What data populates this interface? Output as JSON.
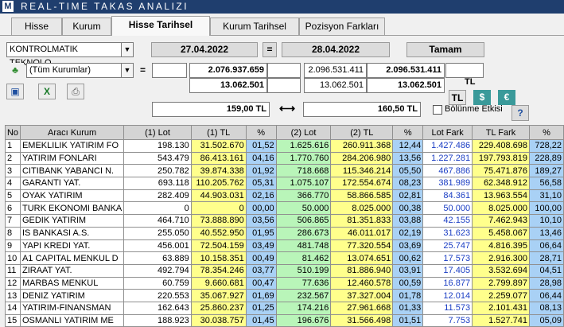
{
  "window": {
    "logo": "M",
    "title": "REAL-TIME TAKAS ANALIZI"
  },
  "tabs": [
    "Hisse",
    "Kurum",
    "Hisse Tarihsel",
    "Kurum Tarihsel",
    "Pozisyon Farkları"
  ],
  "filters": {
    "stock": "KONTROLMATIK TEKNOLO",
    "institution": "(Tüm Kurumlar)",
    "date_from": "27.04.2022",
    "eq": "=",
    "date_to": "28.04.2022",
    "ok_button": "Tamam",
    "eq2": "="
  },
  "summary": {
    "val1a": "2.076.937.659",
    "val1b": "2.096.531.411",
    "val1c": "2.096.531.411",
    "val2a": "13.062.501",
    "val2b": "13.062.501",
    "val2c": "13.062.501",
    "price1": "159,00 TL",
    "arrow": "⟷",
    "price2": "160,50 TL",
    "split_label": "Bölünme Etkisi",
    "currency_label": "TL",
    "currency_tl": "TL",
    "currency_usd": "$",
    "currency_eur": "€",
    "help": "?"
  },
  "table": {
    "headers": [
      "No",
      "Aracı Kurum",
      "(1) Lot",
      "(1) TL",
      "%",
      "(2) Lot",
      "(2) TL",
      "%",
      "Lot Fark",
      "TL Fark",
      "%"
    ],
    "rows": [
      [
        "1",
        "EMEKLILIK YATIRIM FO",
        "198.130",
        "31.502.670",
        "01,52",
        "1.625.616",
        "260.911.368",
        "12,44",
        "1.427.486",
        "229.408.698",
        "728,22"
      ],
      [
        "2",
        "YATIRIM FONLARI",
        "543.479",
        "86.413.161",
        "04,16",
        "1.770.760",
        "284.206.980",
        "13,56",
        "1.227.281",
        "197.793.819",
        "228,89"
      ],
      [
        "3",
        "CITIBANK YABANCI N.",
        "250.782",
        "39.874.338",
        "01,92",
        "718.668",
        "115.346.214",
        "05,50",
        "467.886",
        "75.471.876",
        "189,27"
      ],
      [
        "4",
        "GARANTI YAT.",
        "693.118",
        "110.205.762",
        "05,31",
        "1.075.107",
        "172.554.674",
        "08,23",
        "381.989",
        "62.348.912",
        "56,58"
      ],
      [
        "5",
        "OYAK YATIRIM",
        "282.409",
        "44.903.031",
        "02,16",
        "366.770",
        "58.866.585",
        "02,81",
        "84.361",
        "13.963.554",
        "31,10"
      ],
      [
        "6",
        "TURK EKONOMI BANKA",
        "0",
        "0",
        "00,00",
        "50.000",
        "8.025.000",
        "00,38",
        "50.000",
        "8.025.000",
        "100,00"
      ],
      [
        "7",
        "GEDIK YATIRIM",
        "464.710",
        "73.888.890",
        "03,56",
        "506.865",
        "81.351.833",
        "03,88",
        "42.155",
        "7.462.943",
        "10,10"
      ],
      [
        "8",
        "IS BANKASI A.S.",
        "255.050",
        "40.552.950",
        "01,95",
        "286.673",
        "46.011.017",
        "02,19",
        "31.623",
        "5.458.067",
        "13,46"
      ],
      [
        "9",
        "YAPI KREDI YAT.",
        "456.001",
        "72.504.159",
        "03,49",
        "481.748",
        "77.320.554",
        "03,69",
        "25.747",
        "4.816.395",
        "06,64"
      ],
      [
        "10",
        "A1 CAPITAL MENKUL D",
        "63.889",
        "10.158.351",
        "00,49",
        "81.462",
        "13.074.651",
        "00,62",
        "17.573",
        "2.916.300",
        "28,71"
      ],
      [
        "11",
        "ZIRAAT YAT.",
        "492.794",
        "78.354.246",
        "03,77",
        "510.199",
        "81.886.940",
        "03,91",
        "17.405",
        "3.532.694",
        "04,51"
      ],
      [
        "12",
        "MARBAS MENKUL",
        "60.759",
        "9.660.681",
        "00,47",
        "77.636",
        "12.460.578",
        "00,59",
        "16.877",
        "2.799.897",
        "28,98"
      ],
      [
        "13",
        "DENIZ YATIRIM",
        "220.553",
        "35.067.927",
        "01,69",
        "232.567",
        "37.327.004",
        "01,78",
        "12.014",
        "2.259.077",
        "06,44"
      ],
      [
        "14",
        "YATIRIM-FINANSMAN",
        "162.643",
        "25.860.237",
        "01,25",
        "174.216",
        "27.961.668",
        "01,33",
        "11.573",
        "2.101.431",
        "08,13"
      ],
      [
        "15",
        "OSMANLI YATIRIM ME",
        "188.923",
        "30.038.757",
        "01,45",
        "196.676",
        "31.566.498",
        "01,51",
        "7.753",
        "1.527.741",
        "05,09"
      ]
    ]
  },
  "colors": {
    "title_bg": "#1f3e6e",
    "yellow": "#ffff8c",
    "blue": "#a9d1f5",
    "green": "#b9f5b9",
    "lot_fark_text": "#1a3dc4"
  }
}
